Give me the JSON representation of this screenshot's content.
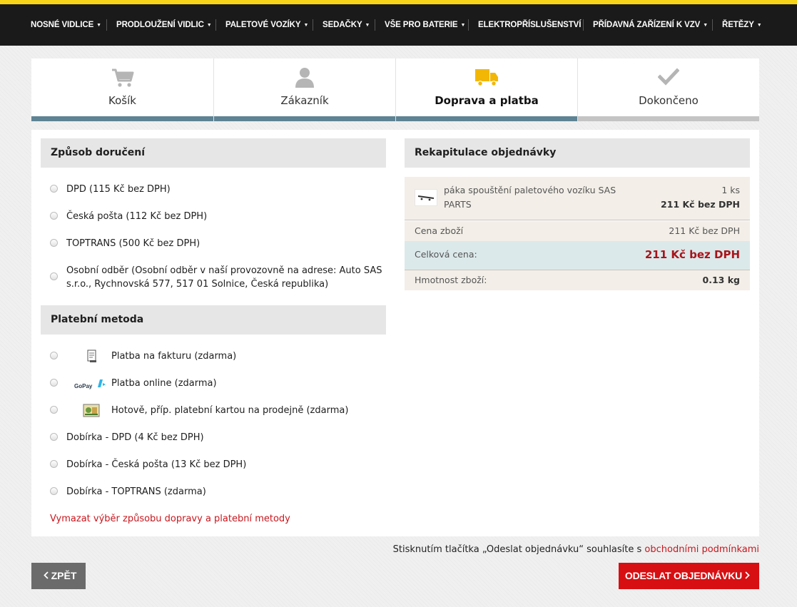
{
  "nav": {
    "items": [
      {
        "label": "NOSNÉ VIDLICE",
        "caret": "▼"
      },
      {
        "label": "PRODLOUŽENÍ VIDLIC",
        "caret": "▼"
      },
      {
        "label": "PALETOVÉ VOZÍKY",
        "caret": "▼"
      },
      {
        "label": "SEDAČKY",
        "caret": "▼"
      },
      {
        "label": "VŠE PRO BATERIE",
        "caret": "▼"
      },
      {
        "label": "ELEKTROPŘÍSLUŠENSTVÍ",
        "caret": ""
      },
      {
        "label": "PŘÍDAVNÁ ZAŘÍZENÍ K VZV",
        "caret": "▼"
      },
      {
        "label": "ŘETĚZY",
        "caret": "▼"
      }
    ]
  },
  "steps": [
    {
      "label": "Košík",
      "icon": "cart-icon",
      "state": "done"
    },
    {
      "label": "Zákazník",
      "icon": "user-icon",
      "state": "done"
    },
    {
      "label": "Doprava a platba",
      "icon": "truck-icon",
      "state": "active"
    },
    {
      "label": "Dokončeno",
      "icon": "check-icon",
      "state": "todo"
    }
  ],
  "delivery": {
    "title": "Způsob doručení",
    "options": [
      {
        "label": "DPD (115 Kč bez DPH)"
      },
      {
        "label": "Česká pošta (112 Kč bez DPH)"
      },
      {
        "label": "TOPTRANS (500 Kč bez DPH)"
      },
      {
        "label": "Osobní odběr (Osobní odběr v naší provozovně na adrese: Auto SAS s.r.o., Rychnovská 577, 517 01 Solnice, Česká republika)"
      }
    ]
  },
  "payment": {
    "title": "Platební metoda",
    "options": [
      {
        "label": "Platba na fakturu (zdarma)",
        "icon": "invoice-icon"
      },
      {
        "label": "Platba online (zdarma)",
        "icon": "gopay-logo",
        "logo_text": "GoPay"
      },
      {
        "label": "Hotově, příp. platební kartou na prodejně (zdarma)",
        "icon": "cash-icon"
      },
      {
        "label": "Dobírka - DPD (4 Kč bez DPH)"
      },
      {
        "label": "Dobírka - Česká pošta (13 Kč bez DPH)"
      },
      {
        "label": "Dobírka - TOPTRANS (zdarma)"
      }
    ],
    "clear_link": "Vymazat výběr způsobu dopravy a platební metody"
  },
  "recap": {
    "title": "Rekapitulace objednávky",
    "item": {
      "name": "páka spouštění paletového vozíku SAS PARTS",
      "qty": "1 ks",
      "price": "211 Kč bez DPH"
    },
    "goods_price": {
      "label": "Cena zboží",
      "value": "211 Kč bez DPH"
    },
    "total": {
      "label": "Celková cena:",
      "value": "211 Kč bez DPH"
    },
    "weight": {
      "label": "Hmotnost zboží:",
      "value": "0.13 kg"
    }
  },
  "terms": {
    "text": "Stisknutím tlačítka „Odeslat objednávku“ souhlasíte s ",
    "link": "obchodními podmínkami"
  },
  "buttons": {
    "back": "ZPĚT",
    "submit": "ODESLAT OBJEDNÁVKU"
  },
  "colors": {
    "accent_yellow": "#f7d417",
    "nav_bg": "#1a1a1a",
    "step_done": "#5e8394",
    "step_todo": "#c4c4c4",
    "total_price": "#a8141a",
    "link_red": "#c8161c",
    "submit_red": "#d70f12"
  }
}
